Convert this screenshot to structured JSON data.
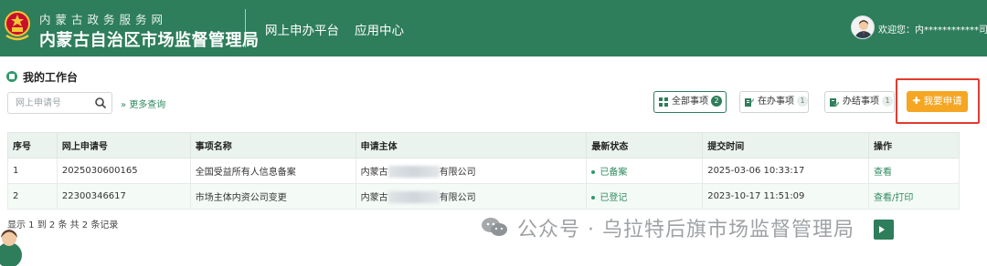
{
  "header": {
    "site_sub": "内蒙古政务服务网",
    "site_title": "内蒙古自治区市场监督管理局",
    "nav": [
      "网上申办平台",
      "应用中心"
    ],
    "welcome": "欢迎您：内************司",
    "brand_color": "#2e7d5b"
  },
  "workbench": {
    "title": "我的工作台",
    "search_placeholder": "网上申请号",
    "more_query": "更多查询",
    "filters": [
      {
        "label": "全部事项",
        "count": "2",
        "active": true
      },
      {
        "label": "在办事项",
        "count": "1",
        "active": false
      },
      {
        "label": "办结事项",
        "count": "1",
        "active": false
      }
    ],
    "apply_button": "我要申请",
    "apply_color": "#f5a623",
    "highlight_color": "#e23b2e"
  },
  "table": {
    "headers": [
      "序号",
      "网上申请号",
      "事项名称",
      "申请主体",
      "最新状态",
      "提交时间",
      "操作"
    ],
    "rows": [
      {
        "no": "1",
        "app_no": "2025030600165",
        "item": "全国受益所有人信息备案",
        "subject_prefix": "内蒙古",
        "subject_suffix": "有限公司",
        "status": "已备案",
        "time": "2025-03-06 10:33:17",
        "action": "查看"
      },
      {
        "no": "2",
        "app_no": "22300346617",
        "item": "市场主体内资公司变更",
        "subject_prefix": "内蒙古",
        "subject_suffix": "有限公司",
        "status": "已登记",
        "time": "2023-10-17 11:51:09",
        "action": "查看/打印"
      }
    ],
    "summary": "显示 1 到 2 条 共 2 条记录"
  },
  "watermark": {
    "text": "公众号 · 乌拉特后旗市场监督管理局"
  },
  "icons": {
    "search": "search-icon",
    "filter_all": "grid-icon",
    "filter_doing": "doc-edit-icon",
    "filter_done": "doc-check-icon",
    "more": "double-chevron-down-icon",
    "apply": "plus-icon"
  }
}
